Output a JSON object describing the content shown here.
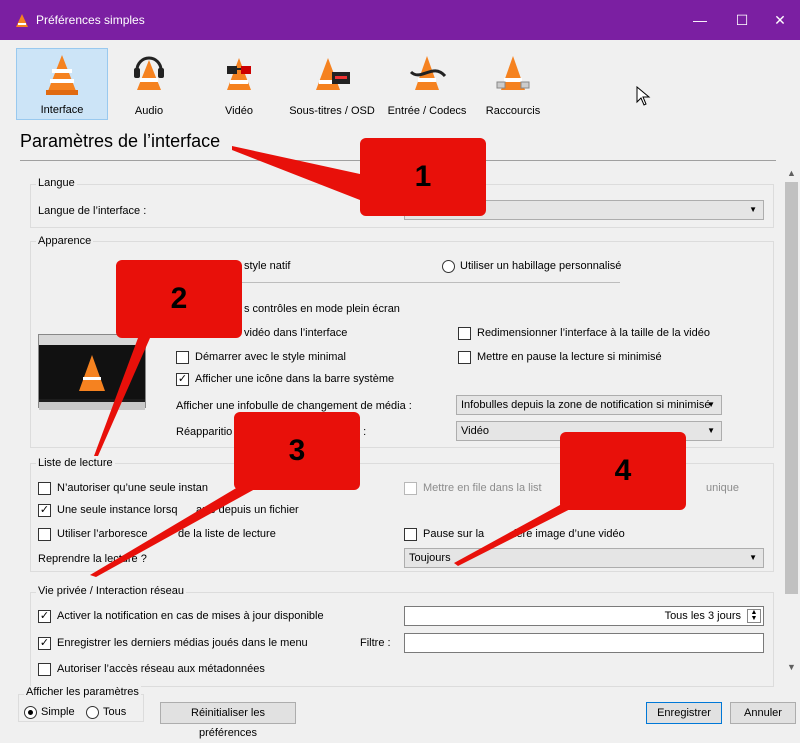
{
  "window": {
    "title": "Préférences simples",
    "controls": [
      "—",
      "☐",
      "✕"
    ]
  },
  "toolbar": {
    "items": [
      {
        "label": "Interface",
        "icon": "vlc-cone-icon",
        "selected": true
      },
      {
        "label": "Audio",
        "icon": "headphones-cone-icon"
      },
      {
        "label": "Vidéo",
        "icon": "glasses-cone-icon"
      },
      {
        "label": "Sous-titres / OSD",
        "icon": "subtitles-cone-icon"
      },
      {
        "label": "Entrée / Codecs",
        "icon": "cable-cone-icon"
      },
      {
        "label": "Raccourcis",
        "icon": "hotkeys-cone-icon"
      }
    ]
  },
  "page": {
    "title": "Paramètres de l’interface"
  },
  "langue": {
    "group_title": "Langue",
    "label": "Langue de l’interface :",
    "value": ""
  },
  "apparence": {
    "group_title": "Apparence",
    "radio_native": "style natif",
    "radio_skin": "Utiliser un habillage personnalisé",
    "cb_fullscreen": "s contrôles en mode plein écran",
    "cb_integrate": "vidéo dans l’interface",
    "cb_resize": "Redimensionner l’interface à la taille de la vidéo",
    "cb_minimal": "Démarrer avec le style minimal",
    "cb_pause_min": "Mettre en pause la lecture si minimisé",
    "cb_systray": "Afficher une icône dans la barre système",
    "notif_label": "Afficher une infobulle de changement de média :",
    "notif_value": "Infobulles depuis la zone de notification si minimisé",
    "reappear_label": "Réapparitio",
    "reappear_label_end": "e :",
    "reappear_value": "Vidéo"
  },
  "playlist": {
    "group_title": "Liste de lecture",
    "cb_single": "N’autoriser qu’une seule instan",
    "cb_enqueue": "Mettre en file dans la list",
    "cb_enqueue_end": "unique",
    "cb_single_file": "Une seule instance lorsq",
    "cb_single_file_end": "arré depuis un fichier",
    "cb_tree": "Utiliser l’arboresce",
    "cb_tree_end": "de la liste de lecture",
    "cb_pause_last": "Pause sur la",
    "cb_pause_last_end": "ière image d’une vidéo",
    "resume_label": "Reprendre la lecture ?",
    "resume_value": "Toujours"
  },
  "privacy": {
    "group_title": "Vie privée / Interaction réseau",
    "cb_updates": "Activer la notification en cas de mises à jour disponible",
    "updates_value": "Tous les 3 jours",
    "cb_recent": "Enregistrer les derniers médias joués dans le menu",
    "filter_label": "Filtre :",
    "filter_value": "",
    "cb_network": "Autoriser l’accès réseau aux métadonnées"
  },
  "footer": {
    "show_label": "Afficher les paramètres",
    "radio_simple": "Simple",
    "radio_all": "Tous",
    "reset_btn": "Réinitialiser les préférences",
    "save_btn": "Enregistrer",
    "cancel_btn": "Annuler"
  },
  "callouts": [
    "1",
    "2",
    "3",
    "4"
  ],
  "colors": {
    "titlebar": "#7b1fa2",
    "callout": "#e8100a",
    "accent": "#0078d7"
  }
}
